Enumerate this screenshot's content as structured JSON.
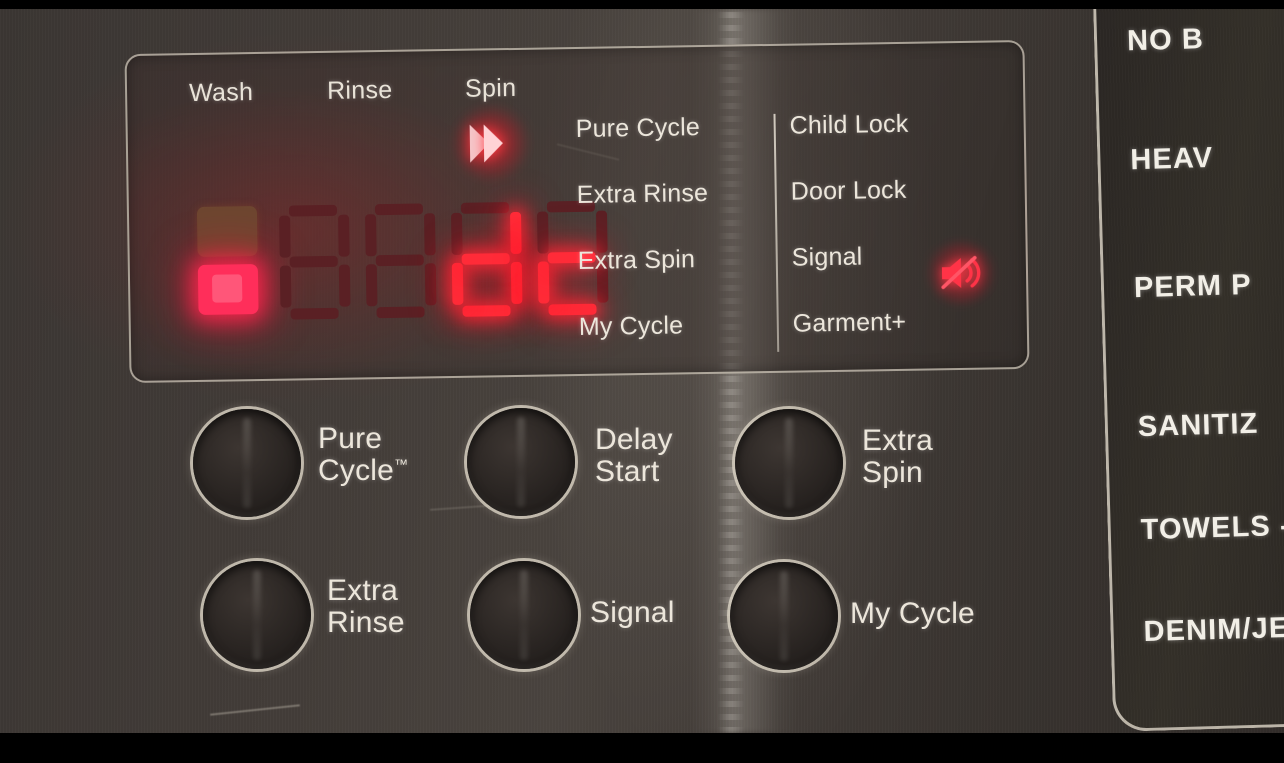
{
  "device": {
    "type": "front-load-washer-control-panel",
    "display_state": "error"
  },
  "display": {
    "phases": [
      {
        "label": "Wash",
        "active": false
      },
      {
        "label": "Rinse",
        "active": false
      },
      {
        "label": "Spin",
        "active": true
      }
    ],
    "spin_indicator_icon": "double-chevron-right-icon",
    "readout": {
      "text": "dc",
      "meaning": "unbalanced load error code",
      "digit_count": 4,
      "digits": [
        {
          "type": "icon",
          "value": "load-level-icon",
          "lit": "bottom-half"
        },
        {
          "type": "segment",
          "value": "",
          "lit": false
        },
        {
          "type": "segment",
          "value": "",
          "lit": false
        },
        {
          "type": "segment",
          "value": "d",
          "lit": true
        },
        {
          "type": "segment",
          "value": "c",
          "lit": true
        }
      ],
      "color_on": "#ff2b38",
      "color_off": "#5a2024"
    },
    "status_left": [
      {
        "label": "Pure Cycle",
        "lit": false
      },
      {
        "label": "Extra Rinse",
        "lit": false
      },
      {
        "label": "Extra Spin",
        "lit": false
      },
      {
        "label": "My Cycle",
        "lit": false
      }
    ],
    "status_right": [
      {
        "label": "Child Lock",
        "lit": false,
        "icon": null
      },
      {
        "label": "Door Lock",
        "lit": false,
        "icon": null
      },
      {
        "label": "Signal",
        "lit": true,
        "icon": "speaker-muted-icon"
      },
      {
        "label": "Garment+",
        "lit": false,
        "icon": null
      }
    ]
  },
  "buttons": [
    {
      "id": "pure-cycle",
      "label": "Pure\nCycle",
      "trademark": "™"
    },
    {
      "id": "delay-start",
      "label": "Delay\nStart",
      "trademark": ""
    },
    {
      "id": "extra-spin",
      "label": "Extra\nSpin",
      "trademark": ""
    },
    {
      "id": "extra-rinse",
      "label": "Extra\nRinse",
      "trademark": ""
    },
    {
      "id": "signal",
      "label": "Signal",
      "trademark": ""
    },
    {
      "id": "my-cycle",
      "label": "My Cycle",
      "trademark": ""
    }
  ],
  "cycle_selector": {
    "note": "labels clipped at right edge of frame",
    "items": [
      "NO B",
      "HEAV",
      "PERM P",
      "SANITIZ",
      "TOWELS -",
      "DENIM/JE"
    ]
  },
  "colors": {
    "panel_base": "#403a36",
    "led_red": "#ff2b38",
    "led_dim": "#5a2024",
    "text": "#ece6db",
    "chrome": "#ded6c7"
  }
}
